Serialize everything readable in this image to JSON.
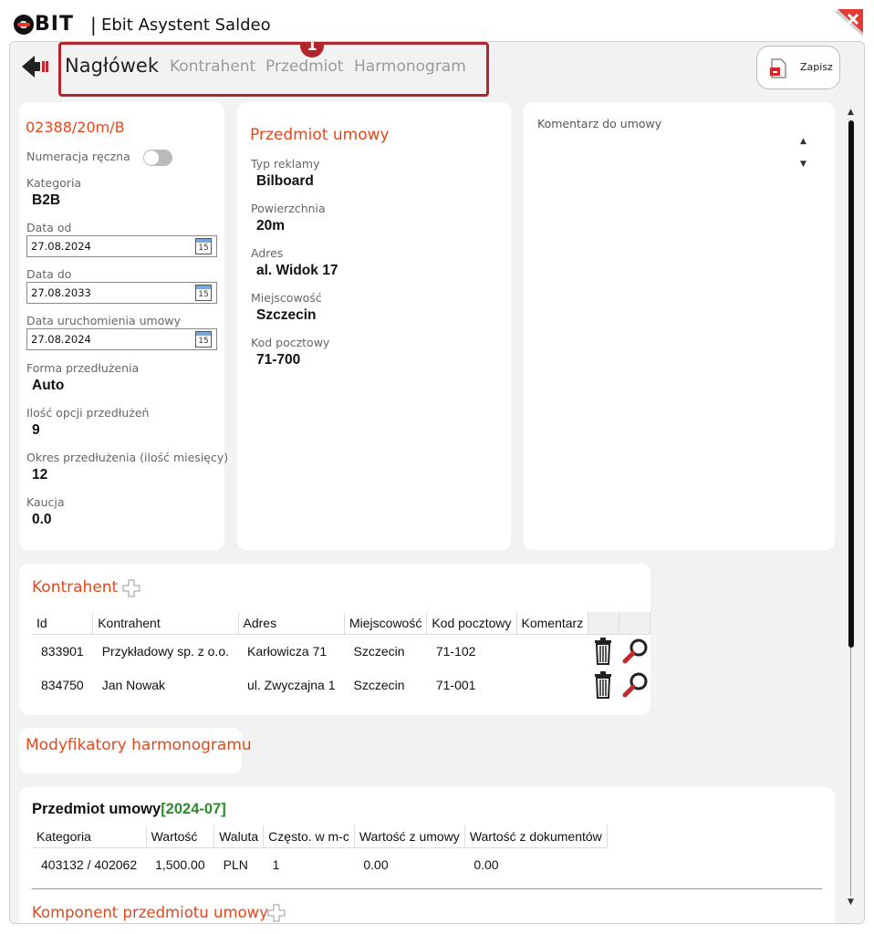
{
  "app": {
    "logo": "BIT",
    "title": "Ebit Asystent Saldeo",
    "separator": "|"
  },
  "tabs": {
    "items": [
      "Nagłówek",
      "Kontrahent",
      "Przedmiot",
      "Harmonogram"
    ],
    "active": "Nagłówek",
    "step_badge": "1"
  },
  "toolbar": {
    "save_label": "Zapisz"
  },
  "header": {
    "contract_number": "02388/20m/B",
    "manual_numbering_label": "Numeracja ręczna",
    "manual_numbering_on": false,
    "category_label": "Kategoria",
    "category": "B2B",
    "date_from_label": "Data od",
    "date_from": "27.08.2024",
    "date_to_label": "Data do",
    "date_to": "27.08.2033",
    "start_date_label": "Data uruchomienia umowy",
    "start_date": "27.08.2024",
    "calendar_icon_text": "15",
    "extension_form_label": "Forma przedłużenia",
    "extension_form": "Auto",
    "extension_options_label": "Ilość opcji przedłużeń",
    "extension_options": "9",
    "extension_period_label": "Okres przedłużenia (ilość miesięcy)",
    "extension_period": "12",
    "deposit_label": "Kaucja",
    "deposit": "0.0"
  },
  "subject": {
    "title": "Przedmiot umowy",
    "ad_type_label": "Typ reklamy",
    "ad_type": "Bilboard",
    "area_label": "Powierzchnia",
    "area": "20m",
    "address_label": "Adres",
    "address": "al. Widok 17",
    "city_label": "Miejscowość",
    "city": "Szczecin",
    "postal_label": "Kod pocztowy",
    "postal": "71-700"
  },
  "comment": {
    "label": "Komentarz do umowy",
    "value": ""
  },
  "contractors": {
    "title": "Kontrahent",
    "columns": [
      "Id",
      "Kontrahent",
      "Adres",
      "Miejscowość",
      "Kod pocztowy",
      "Komentarz",
      "",
      ""
    ],
    "rows": [
      {
        "id": "833901",
        "name": "Przykładowy sp. z o.o.",
        "address": "Karłowicza 71",
        "city": "Szczecin",
        "postal": "71-102",
        "comment": ""
      },
      {
        "id": "834750",
        "name": "Jan Nowak",
        "address": "ul. Zwyczajna 1",
        "city": "Szczecin",
        "postal": "71-001",
        "comment": ""
      }
    ]
  },
  "modifiers": {
    "title": "Modyfikatory harmonogramu"
  },
  "schedule": {
    "title": "Przedmiot umowy",
    "period": "[2024-07]",
    "columns": [
      "Kategoria",
      "Wartość",
      "Waluta",
      "Często. w m-c",
      "Wartość z umowy",
      "Wartość z dokumentów"
    ],
    "rows": [
      {
        "category": "403132 / 402062",
        "value": "1,500.00",
        "currency": "PLN",
        "freq": "1",
        "contract_value": "0.00",
        "doc_value": "0.00"
      }
    ],
    "component_title": "Komponent przedmiotu umowy"
  },
  "colors": {
    "accent": "#e2481d",
    "highlight_frame": "#b4252a",
    "positive": "#2e8a2e"
  }
}
